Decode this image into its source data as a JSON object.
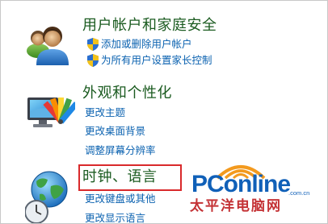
{
  "categories": [
    {
      "title": "用户帐户和家庭安全",
      "icon": "user-accounts-icon",
      "links": [
        {
          "label": "添加或删除用户帐户",
          "icon": "uac-shield-icon"
        },
        {
          "label": "为所有用户设置家长控制",
          "icon": "uac-shield-icon"
        }
      ]
    },
    {
      "title": "外观和个性化",
      "icon": "appearance-icon",
      "links": [
        {
          "label": "更改主题"
        },
        {
          "label": "更改桌面背景"
        },
        {
          "label": "调整屏幕分辨率"
        }
      ]
    },
    {
      "title": "时钟、语言",
      "icon": "clock-language-region-icon",
      "links": [
        {
          "label": "更改键盘或其他"
        },
        {
          "label": "更改显示语言"
        }
      ]
    }
  ],
  "watermark": {
    "brand": "PConline",
    "domain": ".com.cn",
    "chinese": "太平洋电脑网"
  },
  "colors": {
    "category_title": "#1b5b20",
    "link": "#0b62b0",
    "highlight": "#d9292b",
    "watermark_blue": "#1060b8",
    "watermark_red": "#c43235",
    "watermark_orange": "#f39a1e"
  }
}
